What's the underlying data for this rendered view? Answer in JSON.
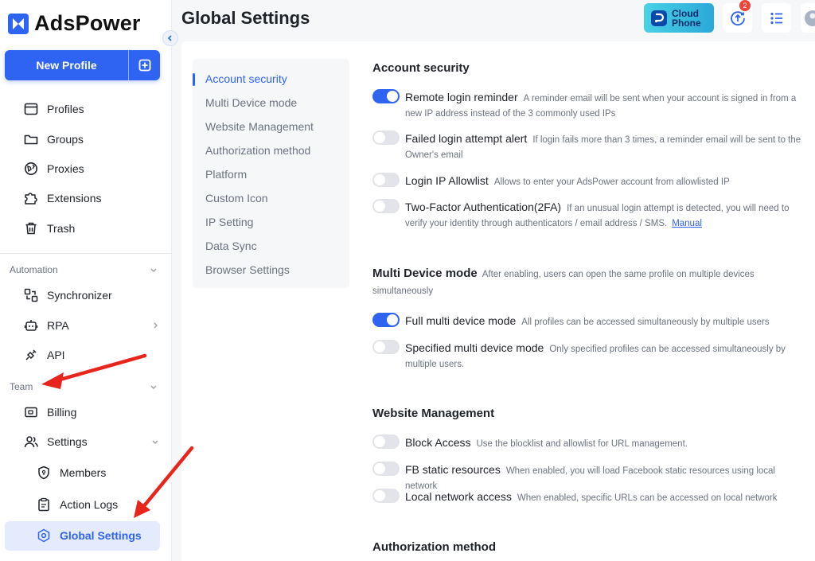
{
  "brand": {
    "name": "AdsPower",
    "accent": "#2f63f2"
  },
  "sidebar": {
    "new_profile_label": "New Profile",
    "items": [
      {
        "label": "Profiles",
        "icon": "profiles-icon"
      },
      {
        "label": "Groups",
        "icon": "folder-icon"
      },
      {
        "label": "Proxies",
        "icon": "proxy-icon"
      },
      {
        "label": "Extensions",
        "icon": "puzzle-icon"
      },
      {
        "label": "Trash",
        "icon": "trash-icon"
      }
    ],
    "automation": {
      "label": "Automation",
      "items": [
        {
          "label": "Synchronizer",
          "icon": "synchronizer-icon"
        },
        {
          "label": "RPA",
          "icon": "robot-icon"
        },
        {
          "label": "API",
          "icon": "api-icon"
        }
      ]
    },
    "team": {
      "label": "Team",
      "items": [
        {
          "label": "Billing",
          "icon": "wallet-icon"
        },
        {
          "label": "Settings",
          "icon": "users-icon"
        }
      ],
      "settings_children": [
        {
          "label": "Members",
          "icon": "shield-icon"
        },
        {
          "label": "Action Logs",
          "icon": "clipboard-icon"
        },
        {
          "label": "Global Settings",
          "icon": "hexagon-gear-icon",
          "active": true
        }
      ]
    }
  },
  "header": {
    "title": "Global Settings",
    "cloud_phone_line1": "Cloud",
    "cloud_phone_line2": "Phone",
    "update_badge": "2"
  },
  "subnav": {
    "items": [
      "Account security",
      "Multi Device mode",
      "Website Management",
      "Authorization method",
      "Platform",
      "Custom Icon",
      "IP Setting",
      "Data Sync",
      "Browser Settings"
    ],
    "active_index": 0
  },
  "sections": {
    "account_security": {
      "title": "Account security",
      "rows": [
        {
          "label": "Remote login reminder",
          "desc": "A reminder email will be sent when your account is signed in from a new IP address instead of the 3 commonly used IPs",
          "on": true
        },
        {
          "label": "Failed login attempt alert",
          "desc": "If login fails more than 3 times, a reminder email will be sent to the Owner's email",
          "on": false
        },
        {
          "label": "Login IP Allowlist",
          "desc": "Allows to enter your AdsPower account from allowlisted IP",
          "on": false
        },
        {
          "label": "Two-Factor Authentication(2FA)",
          "desc": "If an unusual login attempt is detected, you will need to verify your identity through authenticators / email address / SMS.",
          "link": "Manual",
          "on": false
        }
      ]
    },
    "multi_device": {
      "title": "Multi Device mode",
      "desc_inline": "After enabling, users can open the same profile on multiple devices",
      "desc_wrap": "simultaneously",
      "rows": [
        {
          "label": "Full multi device mode",
          "desc": "All profiles can be accessed simultaneously by multiple users",
          "on": true
        },
        {
          "label": "Specified multi device mode",
          "desc": "Only specified profiles can be accessed simultaneously by multiple users.",
          "on": false
        }
      ]
    },
    "website_management": {
      "title": "Website Management",
      "rows": [
        {
          "label": "Block Access",
          "desc": "Use the blocklist and allowlist for URL management.",
          "on": false
        },
        {
          "label": "FB static resources",
          "desc": "When enabled, you will load Facebook static resources using local network",
          "on": false
        },
        {
          "label": "Local network access",
          "desc": "When enabled, specific URLs can be accessed on local network",
          "on": false
        }
      ]
    },
    "authorization": {
      "title": "Authorization method"
    }
  },
  "annotation_color": "#e8251d"
}
